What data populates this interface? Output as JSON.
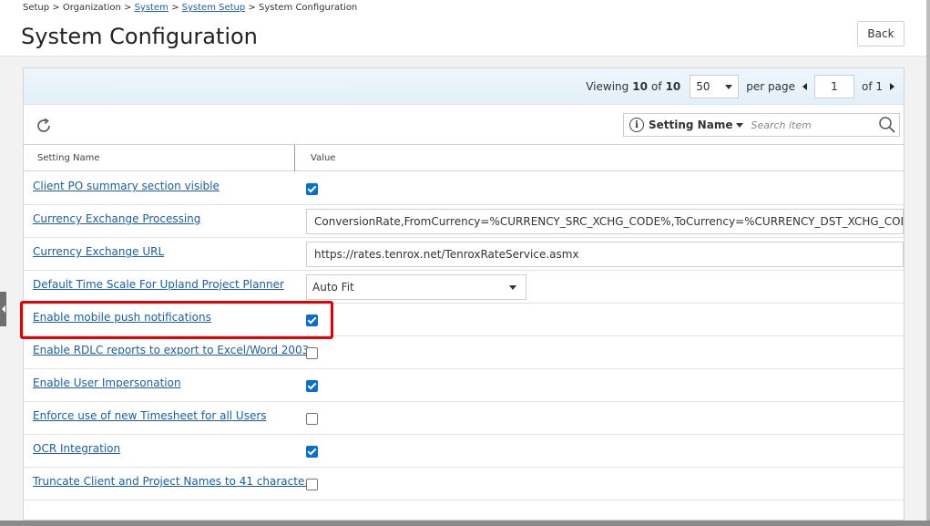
{
  "breadcrumb": {
    "setup": "Setup",
    "organization": "Organization",
    "system": "System",
    "system_setup": "System Setup",
    "current": "System Configuration",
    "separator": ">"
  },
  "page_title": "System Configuration",
  "back_label": "Back",
  "pager": {
    "viewing_label": "Viewing",
    "viewing_count": "10",
    "of_label": "of",
    "total": "10",
    "page_size": "50",
    "per_page_label": "per page",
    "page": "1",
    "of_pages": "of 1"
  },
  "search": {
    "field": "Setting Name",
    "placeholder": "Search item"
  },
  "columns": {
    "name": "Setting Name",
    "value": "Value"
  },
  "rows": [
    {
      "name": "Client PO summary section visible",
      "type": "checkbox",
      "checked": true
    },
    {
      "name": "Currency Exchange Processing",
      "type": "text",
      "value": "ConversionRate,FromCurrency=%CURRENCY_SRC_XCHG_CODE%,ToCurrency=%CURRENCY_DST_XCHG_CODE%"
    },
    {
      "name": "Currency Exchange URL",
      "type": "text",
      "value": "https://rates.tenrox.net/TenroxRateService.asmx"
    },
    {
      "name": "Default Time Scale For Upland Project Planner",
      "type": "select",
      "value": "Auto Fit"
    },
    {
      "name": "Enable mobile push notifications",
      "type": "checkbox",
      "checked": true
    },
    {
      "name": "Enable RDLC reports to export to Excel/Word 2003",
      "type": "checkbox",
      "checked": false
    },
    {
      "name": "Enable User Impersonation",
      "type": "checkbox",
      "checked": true
    },
    {
      "name": "Enforce use of new Timesheet for all Users",
      "type": "checkbox",
      "checked": false
    },
    {
      "name": "OCR Integration",
      "type": "checkbox",
      "checked": true
    },
    {
      "name": "Truncate Client and Project Names to 41 characte...",
      "type": "checkbox",
      "checked": false
    }
  ],
  "colors": {
    "link": "#1a5fa8",
    "checkbox": "#0a6ed1",
    "highlight": "#e60000"
  }
}
